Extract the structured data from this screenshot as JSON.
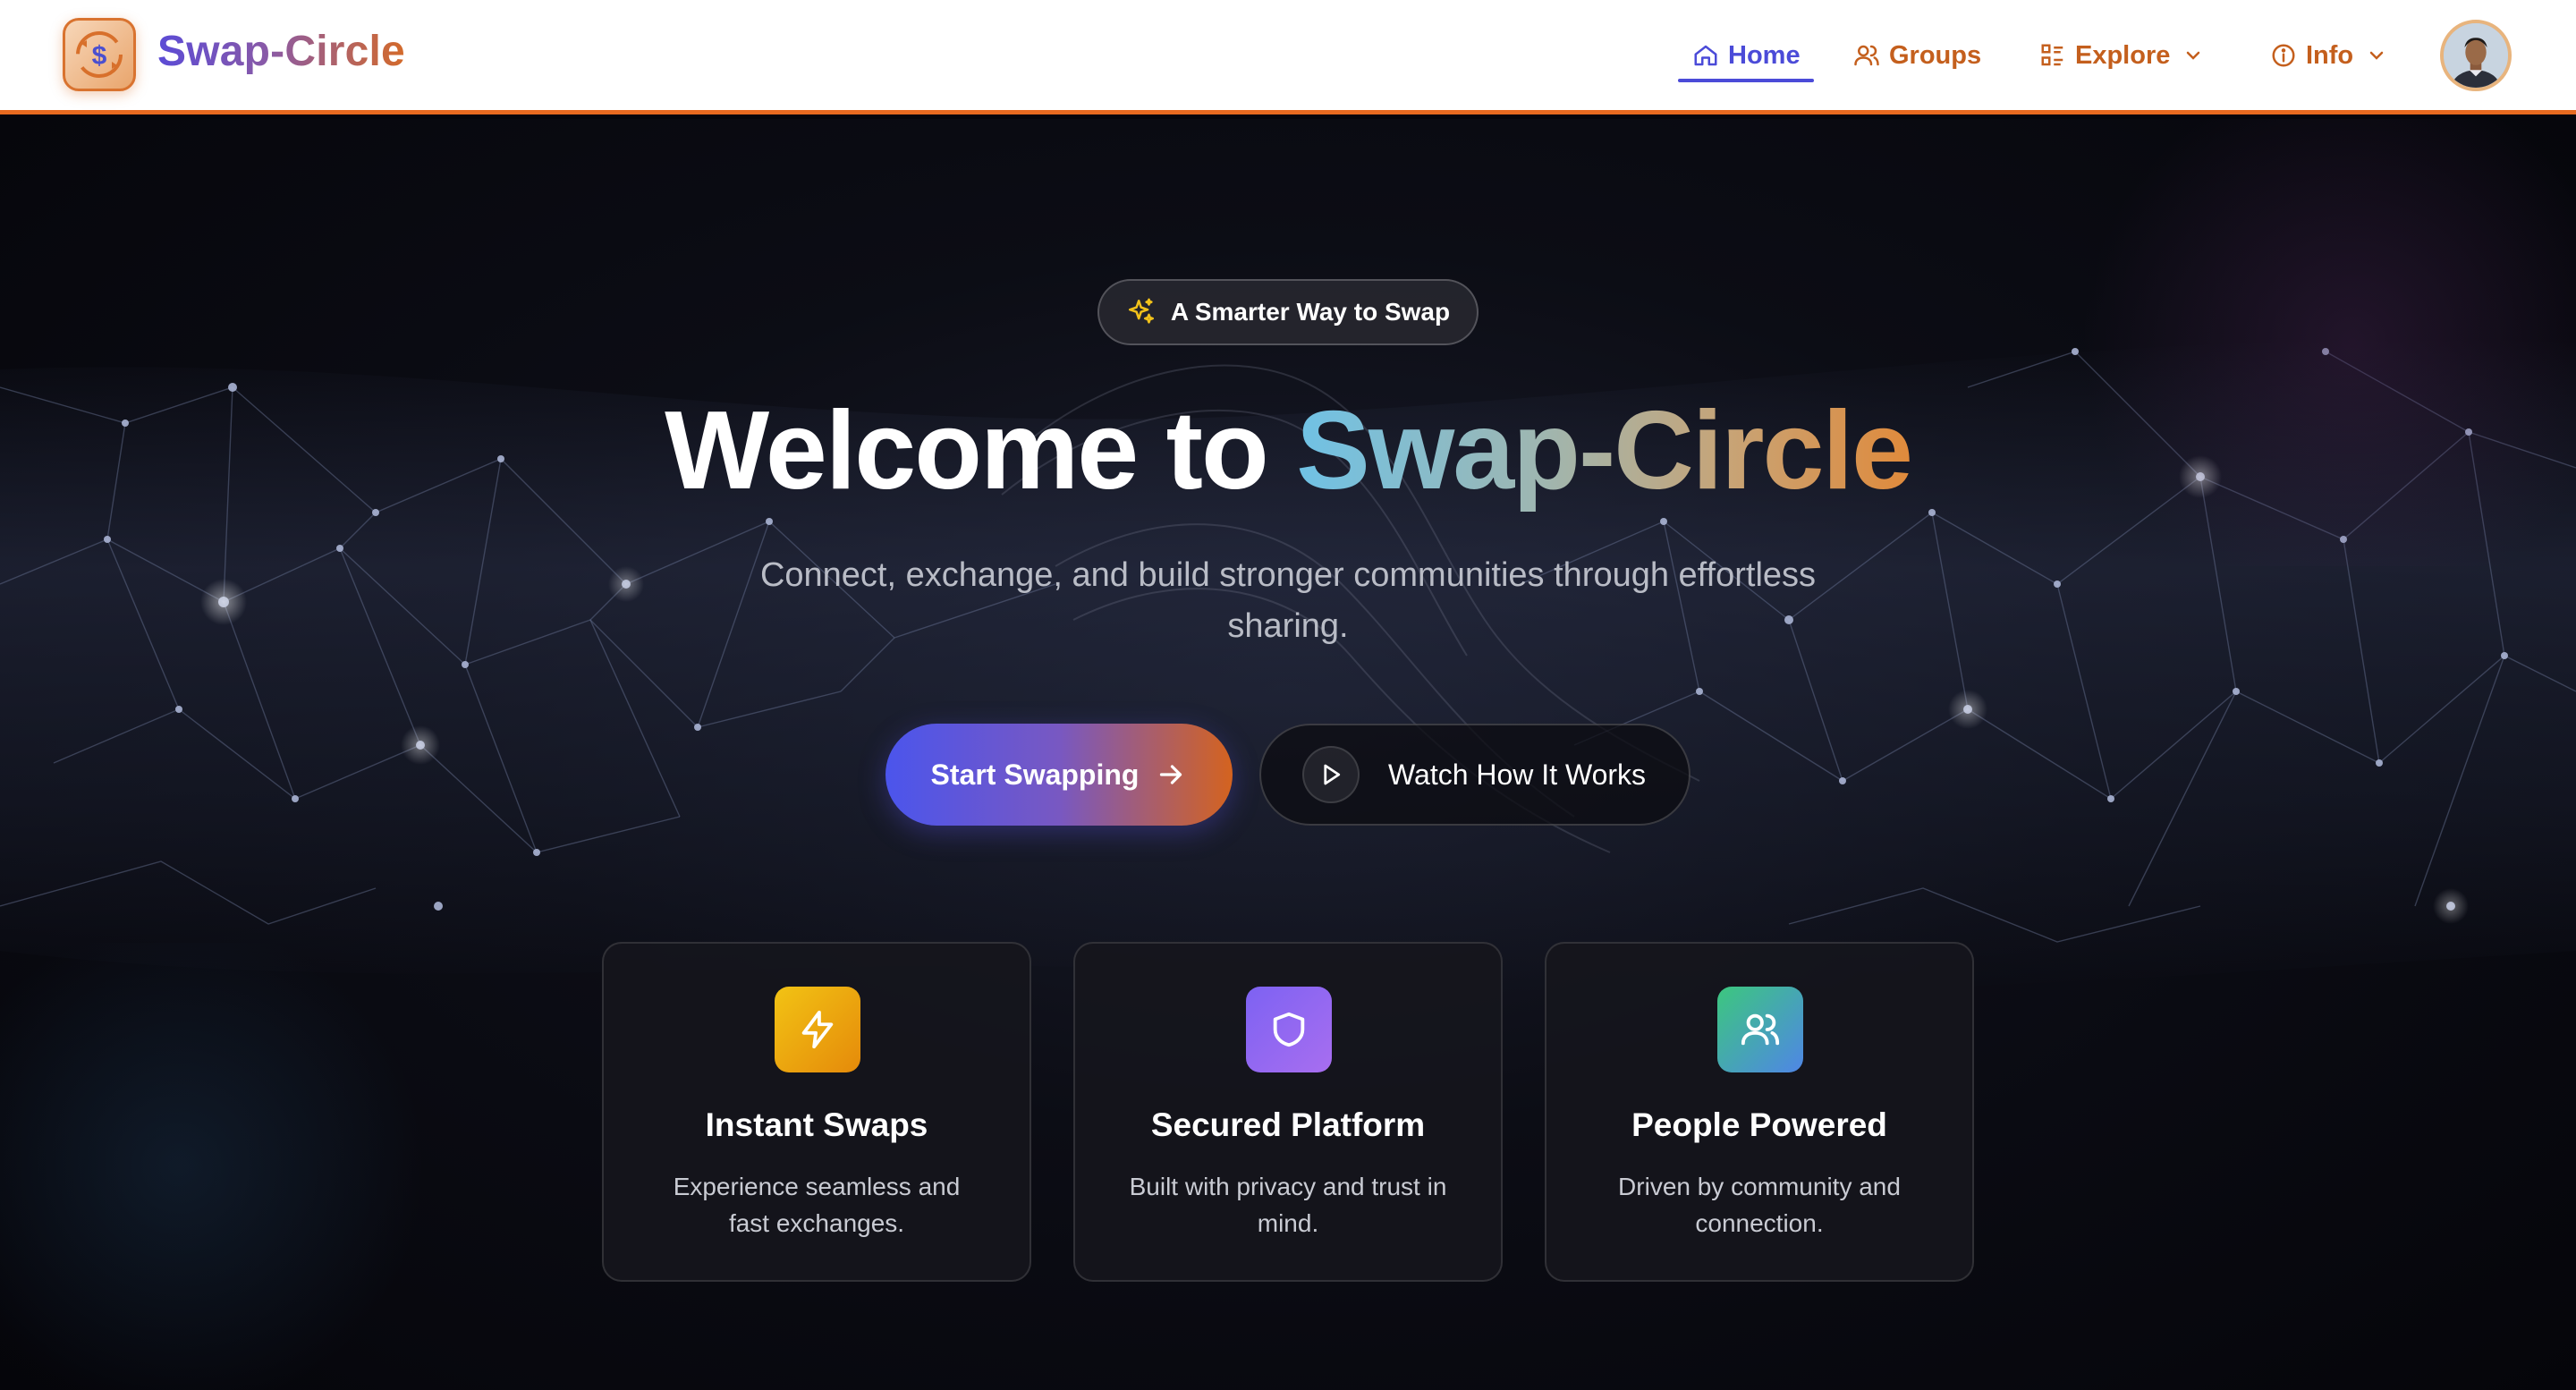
{
  "brand": {
    "name": "Swap-Circle",
    "logo_icon": "swap-dollar-icon"
  },
  "nav": {
    "home": "Home",
    "groups": "Groups",
    "explore": "Explore",
    "info": "Info"
  },
  "hero": {
    "badge": "A Smarter Way to Swap",
    "title_prefix": "Welcome to ",
    "title_highlight": "Swap-Circle",
    "subtitle": "Connect, exchange, and build stronger communities through effortless sharing.",
    "primary_cta": "Start Swapping",
    "secondary_cta": "Watch How It Works"
  },
  "features": [
    {
      "icon": "lightning-icon",
      "title": "Instant Swaps",
      "desc": "Experience seamless and fast exchanges."
    },
    {
      "icon": "shield-icon",
      "title": "Secured Platform",
      "desc": "Built with privacy and trust in mind."
    },
    {
      "icon": "users-icon",
      "title": "People Powered",
      "desc": "Driven by community and connection."
    }
  ],
  "colors": {
    "accent_orange": "#e86a20",
    "accent_indigo": "#4b4bd8",
    "hero_bg": "#07070c"
  }
}
